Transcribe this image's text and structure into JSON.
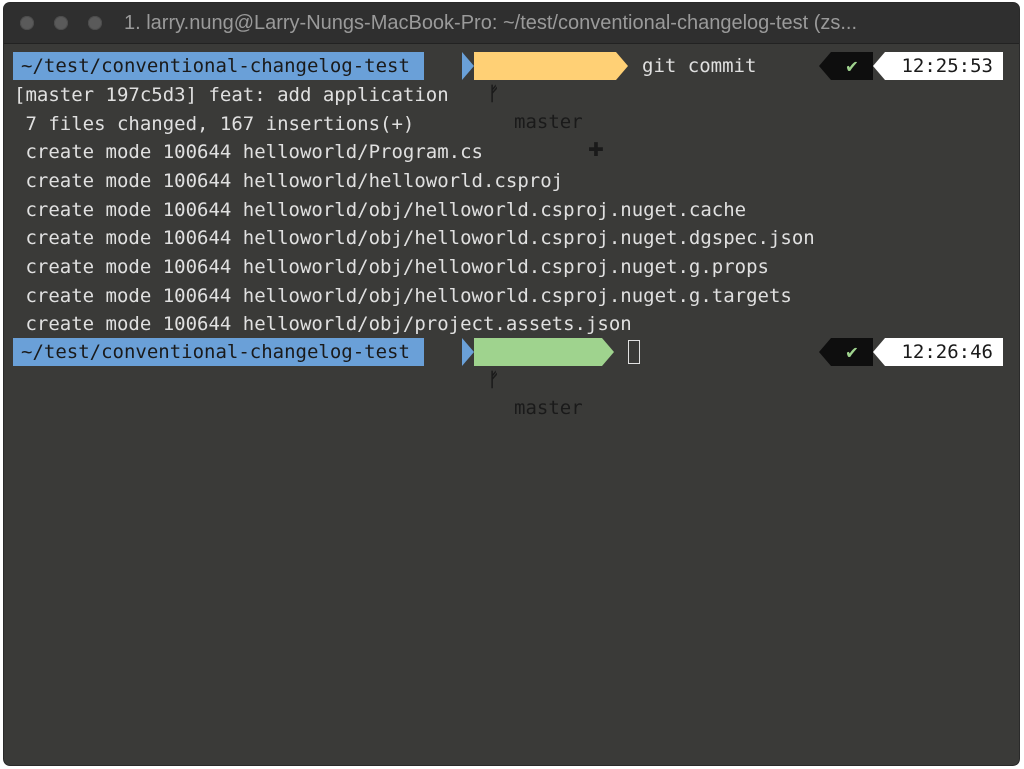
{
  "window": {
    "title": "1. larry.nung@Larry-Nungs-MacBook-Pro: ~/test/conventional-changelog-test (zs..."
  },
  "prompt1": {
    "path": "~/test/conventional-changelog-test",
    "branch_icon": "ᚠ",
    "branch": "master",
    "staged_marker": "✚",
    "command": "git commit",
    "status_icon": "✔",
    "time": "12:25:53"
  },
  "output": [
    "[master 197c5d3] feat: add application",
    " 7 files changed, 167 insertions(+)",
    " create mode 100644 helloworld/Program.cs",
    " create mode 100644 helloworld/helloworld.csproj",
    " create mode 100644 helloworld/obj/helloworld.csproj.nuget.cache",
    " create mode 100644 helloworld/obj/helloworld.csproj.nuget.dgspec.json",
    " create mode 100644 helloworld/obj/helloworld.csproj.nuget.g.props",
    " create mode 100644 helloworld/obj/helloworld.csproj.nuget.g.targets",
    " create mode 100644 helloworld/obj/project.assets.json"
  ],
  "prompt2": {
    "path": "~/test/conventional-changelog-test",
    "branch_icon": "ᚠ",
    "branch": "master",
    "status_icon": "✔",
    "time": "12:26:46"
  },
  "colors": {
    "path_bg": "#6aa0d8",
    "branch_staged_bg": "#ffd075",
    "branch_clean_bg": "#9fd38e",
    "terminal_bg": "#3a3a38"
  }
}
